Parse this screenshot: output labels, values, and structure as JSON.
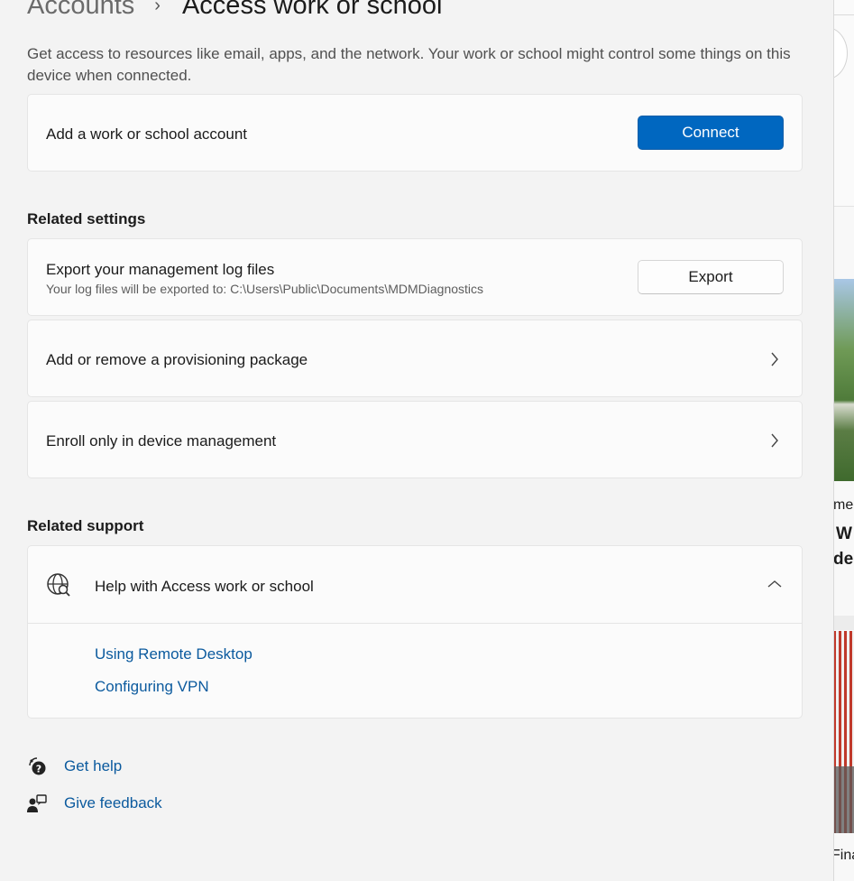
{
  "breadcrumb": {
    "parent": "Accounts",
    "separator": "›",
    "current": "Access work or school"
  },
  "description": "Get access to resources like email, apps, and the network. Your work or school might control some things on this device when connected.",
  "add_account": {
    "label": "Add a work or school account",
    "button": "Connect"
  },
  "related_settings": {
    "heading": "Related settings",
    "export": {
      "title": "Export your management log files",
      "subtitle": "Your log files will be exported to: C:\\Users\\Public\\Documents\\MDMDiagnostics",
      "button": "Export"
    },
    "provisioning": {
      "title": "Add or remove a provisioning package"
    },
    "enroll": {
      "title": "Enroll only in device management"
    }
  },
  "related_support": {
    "heading": "Related support",
    "help_title": "Help with Access work or school",
    "links": [
      "Using Remote Desktop",
      "Configuring VPN"
    ]
  },
  "footer": {
    "get_help": "Get help",
    "give_feedback": "Give feedback"
  },
  "background_window": {
    "source_fragment": "meB",
    "headline_line1": "W",
    "headline_line2": "de",
    "source_fragment2": "Fina"
  },
  "colors": {
    "accent": "#0067c0",
    "link": "#0b5a9e",
    "background": "#f3f3f3",
    "card": "#fbfbfb"
  }
}
